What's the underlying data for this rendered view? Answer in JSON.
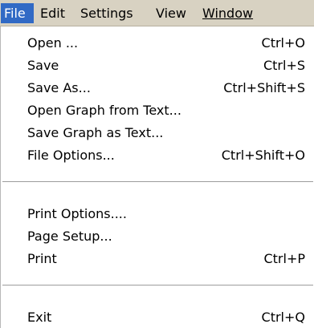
{
  "menubar": {
    "items": [
      {
        "label": "File"
      },
      {
        "label": "Edit"
      },
      {
        "label": "Settings"
      },
      {
        "label": "View"
      },
      {
        "label": "Window"
      }
    ]
  },
  "dropdown": {
    "items": [
      {
        "label": "Open ...",
        "shortcut": "Ctrl+O"
      },
      {
        "label": "Save",
        "shortcut": "Ctrl+S"
      },
      {
        "label": "Save As...",
        "shortcut": "Ctrl+Shift+S"
      },
      {
        "label": "Open Graph from Text...",
        "shortcut": ""
      },
      {
        "label": "Save Graph as Text...",
        "shortcut": ""
      },
      {
        "label": "File Options...",
        "shortcut": "Ctrl+Shift+O"
      },
      {
        "label": "Print Options....",
        "shortcut": ""
      },
      {
        "label": "Page Setup...",
        "shortcut": ""
      },
      {
        "label": "Print",
        "shortcut": "Ctrl+P"
      },
      {
        "label": "Exit",
        "shortcut": "Ctrl+Q"
      }
    ]
  },
  "colors": {
    "menubar_background": "#d8d2c2",
    "selected_background": "#316ac5",
    "selected_text": "#ffffff",
    "menu_background": "#ffffff"
  }
}
